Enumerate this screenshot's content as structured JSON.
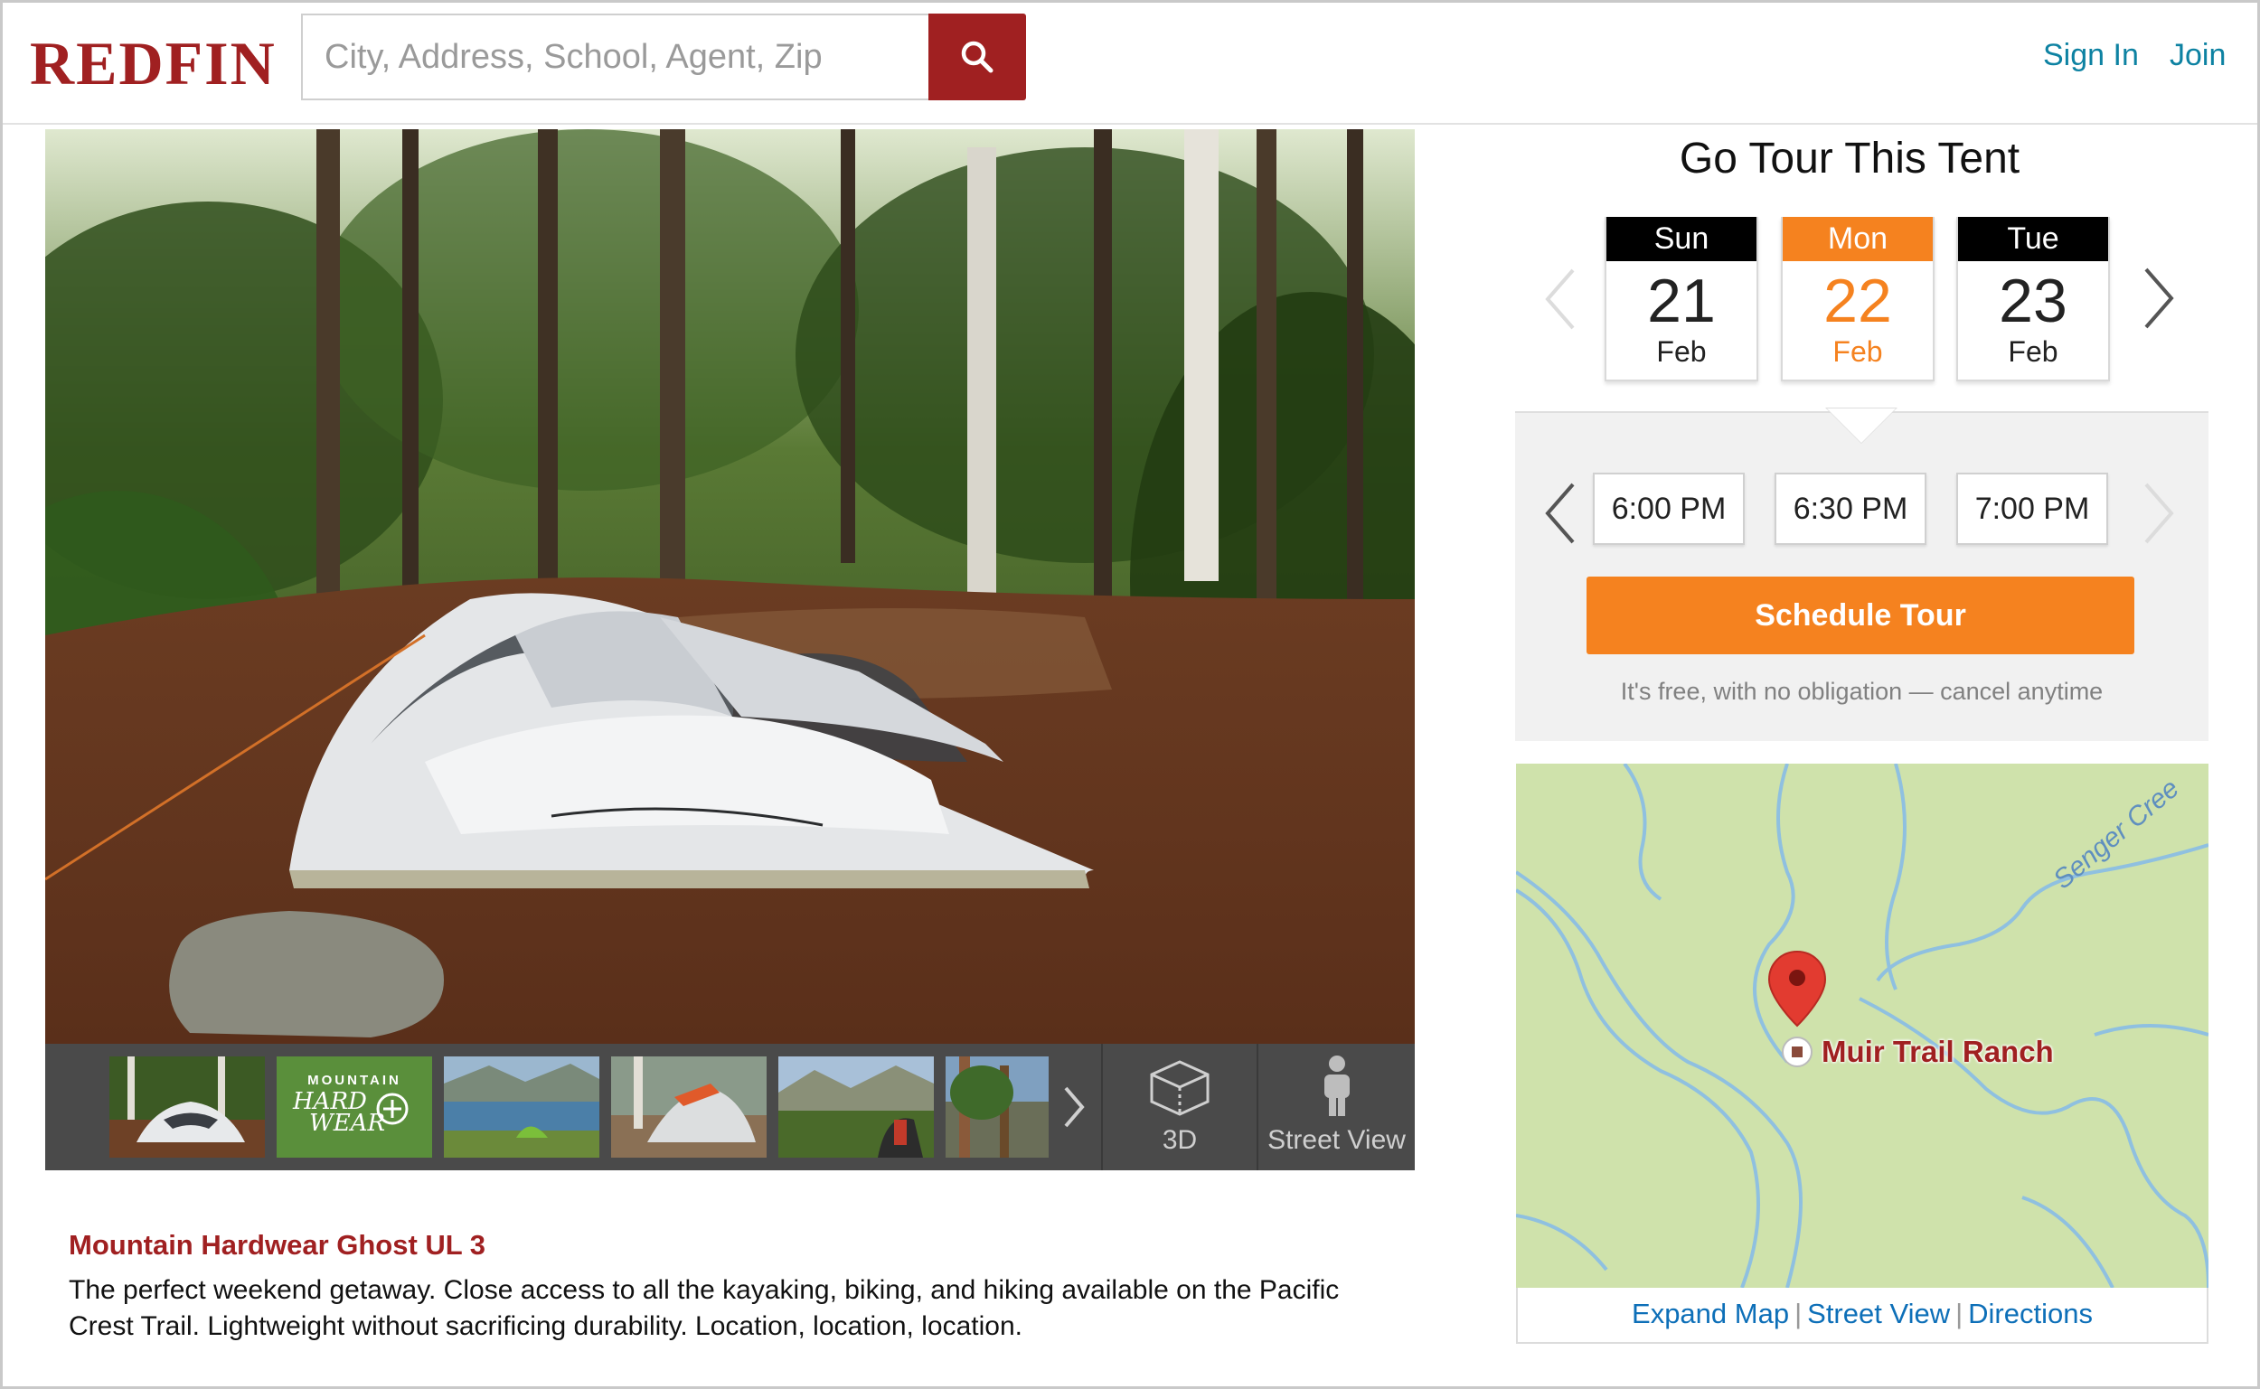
{
  "header": {
    "logo_text": "REDFIN",
    "search_placeholder": "City, Address, School, Agent, Zip",
    "sign_in": "Sign In",
    "join": "Join"
  },
  "photo_strip": {
    "tool_3d_label": "3D",
    "tool_street_view_label": "Street View",
    "brand_thumb_line1": "MOUNTAIN",
    "brand_thumb_line2": "HARD",
    "brand_thumb_line3": "WEAR"
  },
  "listing": {
    "title": "Mountain Hardwear Ghost UL 3",
    "description": "The perfect weekend getaway. Close access to all the kayaking, biking, and hiking available on the Pacific Crest Trail. Lightweight without sacrificing durability. Location, location, location."
  },
  "tour": {
    "title": "Go Tour This Tent",
    "days": [
      {
        "weekday": "Sun",
        "day": "21",
        "month": "Feb",
        "selected": false
      },
      {
        "weekday": "Mon",
        "day": "22",
        "month": "Feb",
        "selected": true
      },
      {
        "weekday": "Tue",
        "day": "23",
        "month": "Feb",
        "selected": false
      }
    ],
    "times": [
      "6:00 PM",
      "6:30 PM",
      "7:00 PM"
    ],
    "schedule_button": "Schedule Tour",
    "note": "It's free, with no obligation — cancel anytime",
    "accent_color": "#f5821f"
  },
  "map": {
    "place_label": "Muir Trail Ranch",
    "creek_label": "Senger Cree",
    "links": {
      "expand": "Expand Map",
      "street_view": "Street View",
      "directions": "Directions"
    }
  },
  "colors": {
    "brand_red": "#a02021",
    "link_blue": "#0d82a2",
    "orange": "#f5821f"
  }
}
